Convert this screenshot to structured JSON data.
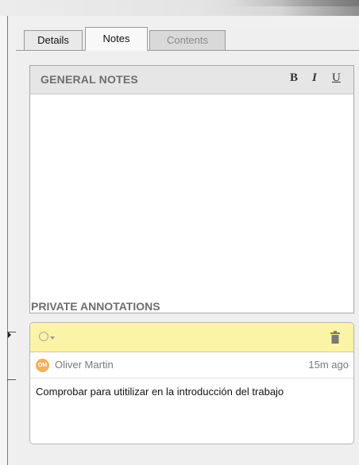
{
  "tabs": [
    {
      "label": "Details"
    },
    {
      "label": "Notes"
    },
    {
      "label": "Contents"
    }
  ],
  "active_tab": "Notes",
  "general_notes": {
    "title": "GENERAL NOTES",
    "format_buttons": {
      "bold": "B",
      "italic": "I",
      "underline": "U"
    },
    "text": ""
  },
  "private_annotations": {
    "title": "PRIVATE ANNOTATIONS",
    "items": [
      {
        "avatar_initials": "OM",
        "author": "Oliver Martin",
        "time": "15m ago",
        "text": "Comprobar para utitilizar en la introducción del trabajo",
        "status_icon": "empty-circle-icon",
        "delete_icon": "trash-icon"
      }
    ]
  },
  "colors": {
    "annotation_toolbar": "#fbf3a6",
    "avatar": "#f6b05a",
    "section_title": "#6e6e6e"
  }
}
